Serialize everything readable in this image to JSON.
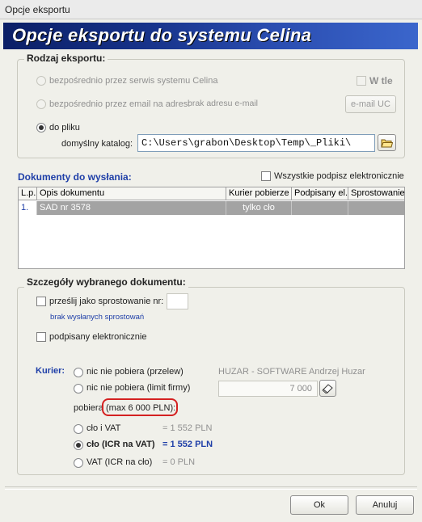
{
  "window": {
    "title": "Opcje eksportu"
  },
  "banner": {
    "title": "Opcje eksportu do systemu Celina"
  },
  "export_type": {
    "legend": "Rodzaj eksportu:",
    "opt_service": "bezpośrednio przez serwis systemu Celina",
    "w_tle": "W tle",
    "opt_email": "bezpośrednio przez email na adres:",
    "email_value": "brak adresu e-mail",
    "email_button": "e-mail UC",
    "opt_file": "do pliku",
    "dir_label": "domyślny katalog:",
    "dir_value": "C:\\Users\\grabon\\Desktop\\Temp\\_Pliki\\",
    "selected": "file"
  },
  "documents": {
    "title": "Dokumenty do wysłania:",
    "sign_all": "Wszystkie podpisz elektronicznie",
    "columns": [
      "L.p.",
      "Opis dokumentu",
      "Kurier pobierze",
      "Podpisany el.",
      "Sprostowanie"
    ],
    "rows": [
      {
        "lp": "1.",
        "opis": "SAD nr 3578",
        "kurier": "tylko cło",
        "podpisany": "",
        "sprostowanie": ""
      }
    ]
  },
  "details": {
    "legend": "Szczegóły wybranego dokumentu:",
    "correction_label": "prześlij jako sprostowanie nr:",
    "correction_value": "",
    "no_corrections": "brak wysłanych sprostowań",
    "signed_label": "podpisany elektronicznie",
    "courier_label": "Kurier:",
    "opt_none_transfer": "nic nie pobiera  (przelew)",
    "opt_none_limit": "nic nie pobiera (limit firmy)",
    "company": "HUZAR - SOFTWARE  Andrzej Huzar",
    "limit_value": "7 000",
    "collects_label": "pobiera",
    "max_note": "(max 6 000 PLN):",
    "opt_duty_vat": "cło i VAT",
    "val_duty_vat": "=   1 552 PLN",
    "opt_duty": "cło (ICR na VAT)",
    "val_duty": "=   1 552 PLN",
    "opt_vat": "VAT (ICR na cło)",
    "val_vat": "=    0 PLN",
    "selected": "duty"
  },
  "buttons": {
    "ok": "Ok",
    "cancel": "Anuluj"
  },
  "colors": {
    "banner_start": "#0b1f66",
    "banner_end": "#3b66cc",
    "selection_row": "#a3a3a3",
    "highlight_box": "#d42121",
    "link_blue": "#1f3fa8"
  }
}
